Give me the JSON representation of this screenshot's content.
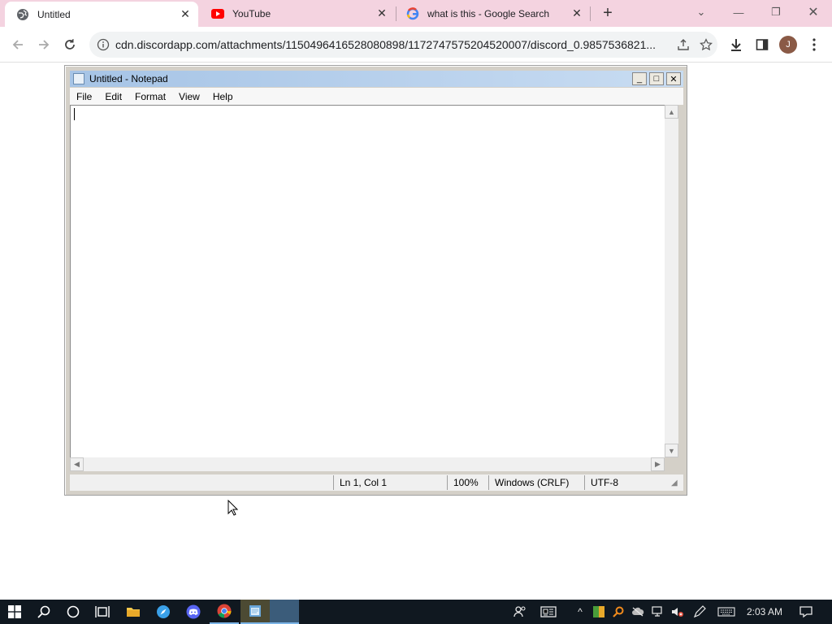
{
  "browser": {
    "tabs": [
      {
        "label": "Untitled",
        "active": true
      },
      {
        "label": "YouTube",
        "active": false
      },
      {
        "label": "what is this - Google Search",
        "active": false
      }
    ],
    "new_tab_label": "+",
    "url": "cdn.discordapp.com/attachments/1150496416528080898/1172747575204520007/discord_0.9857536821...",
    "profile_initial": "J",
    "colors": {
      "tabbar": "#f4d3e0",
      "omnibox": "#f1f3f4"
    }
  },
  "notepad": {
    "title": "Untitled - Notepad",
    "menu": [
      "File",
      "Edit",
      "Format",
      "View",
      "Help"
    ],
    "content": "",
    "status": {
      "position": "Ln 1, Col 1",
      "zoom": "100%",
      "line_ending": "Windows (CRLF)",
      "encoding": "UTF-8"
    }
  },
  "taskbar": {
    "clock": "2:03 AM",
    "icons": [
      "windows-start-icon",
      "search-icon",
      "cortana-icon",
      "task-view-icon",
      "file-explorer-icon",
      "safari-icon",
      "discord-icon",
      "chrome-icon",
      "notepad-app-icon"
    ],
    "colors": {
      "background": "#101820"
    }
  }
}
